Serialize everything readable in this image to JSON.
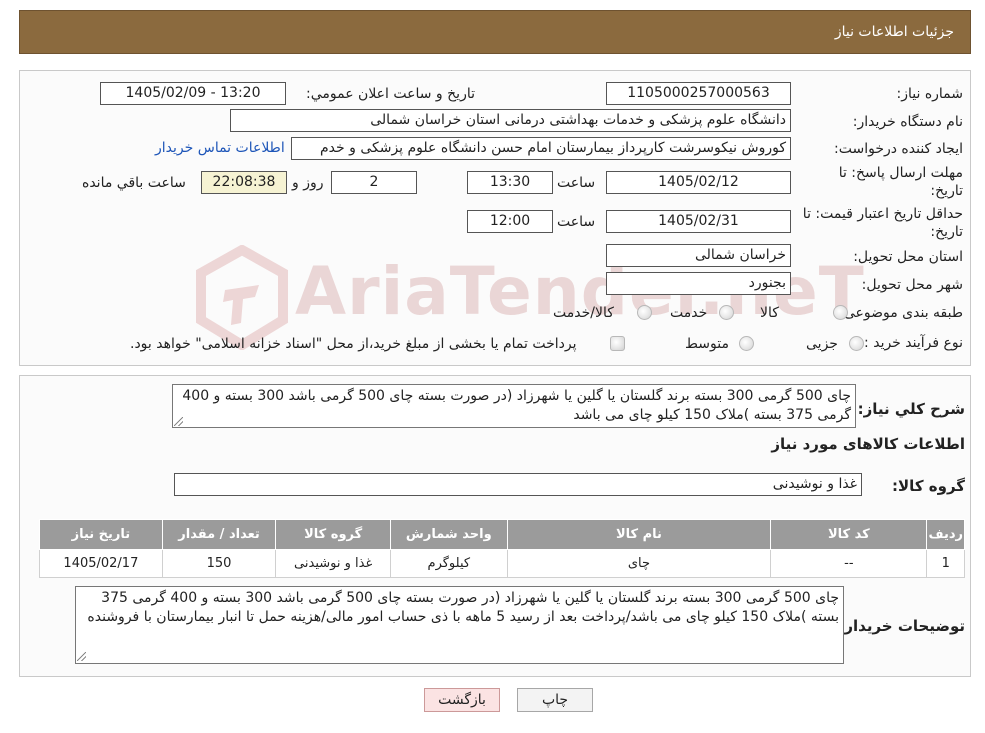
{
  "header": {
    "title": "جزئیات اطلاعات نیاز"
  },
  "watermark": {
    "text": "AriaTender.neT"
  },
  "need": {
    "number_label": "شماره نیاز:",
    "number_value": "1105000257000563",
    "announce_label": "تاریخ و ساعت اعلان عمومي:",
    "announce_value": "1405/02/09 - 13:20",
    "buyer_label": "نام دستگاه خریدار:",
    "buyer_value": "دانشگاه علوم پزشکی و خدمات بهداشتی درمانی استان خراسان شمالی",
    "creator_label": "ایجاد کننده درخواست:",
    "creator_value": "کوروش نیکوسرشت کارپرداز بیمارستان امام حسن دانشگاه علوم پزشکی و خدم",
    "contact_link": "اطلاعات تماس خریدار",
    "deadline_label_1": "مهلت ارسال پاسخ: تا",
    "deadline_label_2": "تاریخ:",
    "deadline_date": "1405/02/12",
    "time_label": "ساعت",
    "deadline_time": "13:30",
    "days_value": "2",
    "days_label": "روز و",
    "remaining_value": "22:08:38",
    "remaining_label": "ساعت باقي مانده",
    "validity_label_1": "حداقل تاریخ اعتبار قیمت: تا",
    "validity_label_2": "تاریخ:",
    "validity_date": "1405/02/31",
    "validity_time": "12:00",
    "province_label": "استان محل تحویل:",
    "province_value": "خراسان شمالی",
    "city_label": "شهر محل تحویل:",
    "city_value": "بجنورد",
    "category_label": "طبقه بندی موضوعی:",
    "category_options": [
      "کالا",
      "خدمت",
      "کالا/خدمت"
    ],
    "process_label": "نوع فرآیند خرید :",
    "process_options": [
      "جزیی",
      "متوسط"
    ],
    "process_note": "پرداخت تمام یا بخشی از مبلغ خرید،از محل \"اسناد خزانه اسلامی\" خواهد بود."
  },
  "details": {
    "summary_label": "شرح کلي نیاز:",
    "summary_value": "چای 500 گرمی 300 بسته برند گلستان یا گلین یا شهرزاد (در صورت بسته چای 500 گرمی باشد 300 بسته و 400 گرمی 375 بسته )ملاک 150 کیلو چای می باشد",
    "goods_info_title": "اطلاعات کالاهای مورد نیاز",
    "group_label": "گروه کالا:",
    "group_value": "غذا و نوشیدنی",
    "table": {
      "headers": [
        "ردیف",
        "کد کالا",
        "نام کالا",
        "واحد شمارش",
        "گروه کالا",
        "تعداد / مقدار",
        "تاریخ نیاز"
      ],
      "rows": [
        [
          "1",
          "--",
          "چای",
          "کیلوگرم",
          "غذا و نوشیدنی",
          "150",
          "1405/02/17"
        ]
      ]
    },
    "buyer_notes_label": "توضیحات خریدار:",
    "buyer_notes_value": "چای 500 گرمی 300 بسته برند گلستان یا گلین یا شهرزاد (در صورت بسته چای 500 گرمی باشد 300 بسته و 400 گرمی 375 بسته )ملاک 150 کیلو چای می باشد/پرداخت بعد از رسید 5 ماهه با ذی حساب امور مالی/هزینه حمل تا انبار بیمارستان با فروشنده"
  },
  "buttons": {
    "print": "چاپ",
    "back": "بازگشت"
  }
}
